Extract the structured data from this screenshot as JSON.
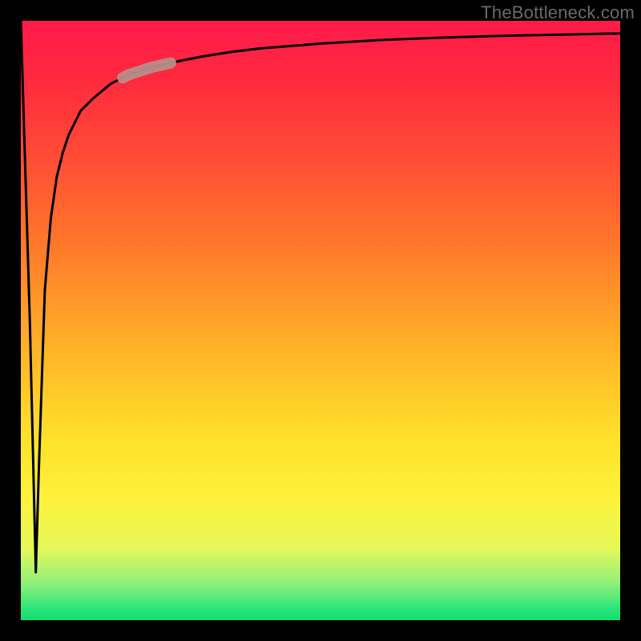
{
  "watermark": "TheBottleneck.com",
  "colors": {
    "frame": "#000000",
    "curve": "#000000",
    "highlight": "#b98d87",
    "gradient_top": "#ff1a4a",
    "gradient_mid": "#ffe22a",
    "gradient_bottom": "#14db6e"
  },
  "chart_data": {
    "type": "line",
    "title": "",
    "xlabel": "",
    "ylabel": "",
    "xlim": [
      0,
      100
    ],
    "ylim": [
      0,
      100
    ],
    "grid": false,
    "legend": false,
    "annotations": [
      {
        "kind": "highlight_segment",
        "x_start": 17,
        "x_end": 25
      }
    ],
    "series": [
      {
        "name": "curve",
        "x": [
          0,
          1.5,
          2.5,
          3,
          4,
          5,
          6,
          7,
          8,
          10,
          12,
          15,
          18,
          22,
          26,
          30,
          35,
          40,
          50,
          60,
          70,
          80,
          90,
          100
        ],
        "values": [
          100,
          50,
          8,
          25,
          55,
          67,
          74,
          78,
          81,
          85,
          87,
          89.5,
          91,
          92.3,
          93.2,
          94,
          94.8,
          95.4,
          96.2,
          96.8,
          97.2,
          97.5,
          97.7,
          97.9
        ]
      }
    ]
  }
}
